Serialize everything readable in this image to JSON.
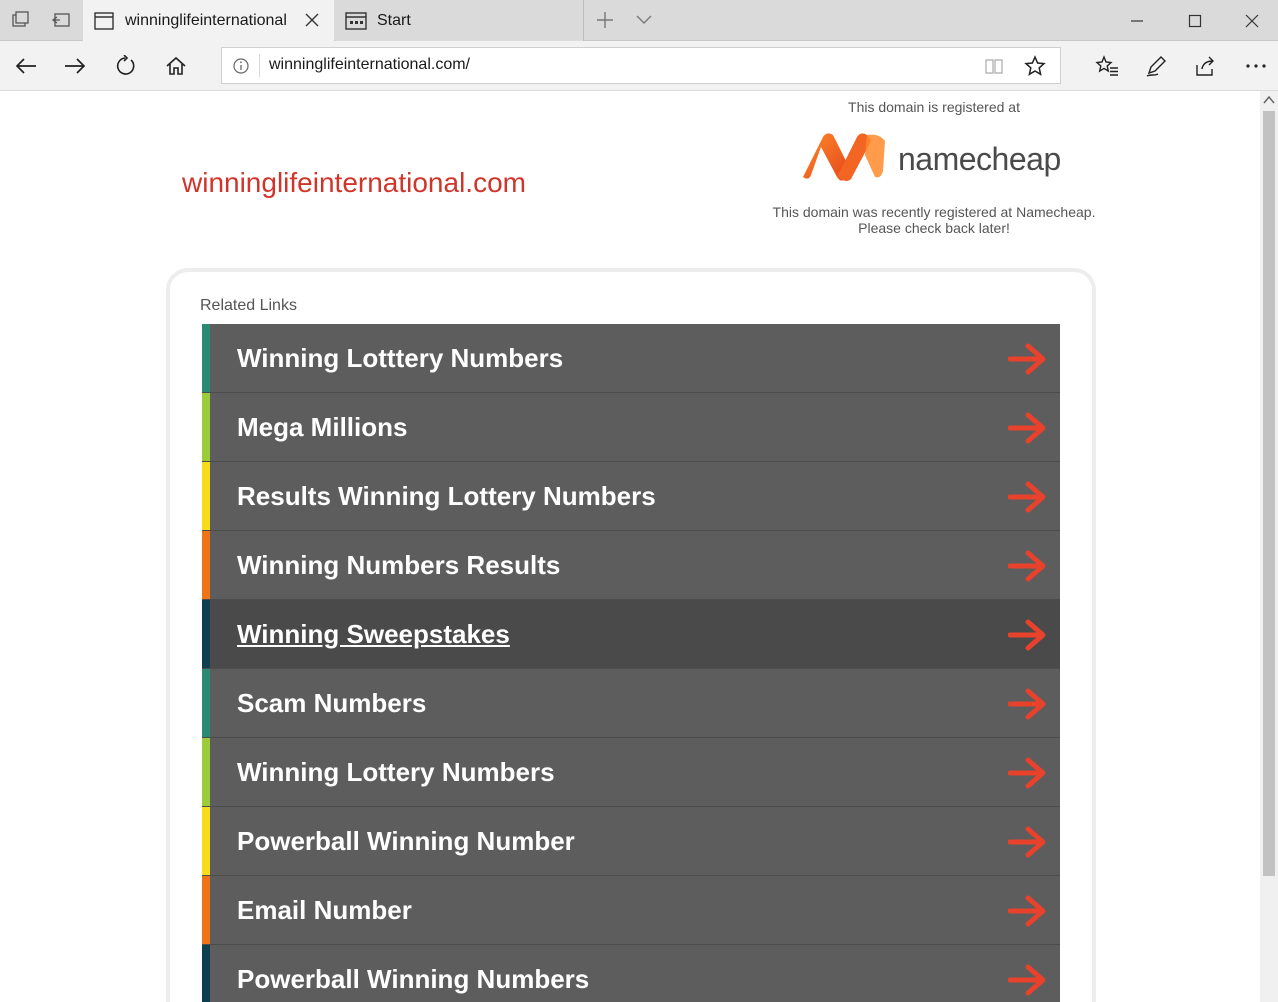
{
  "browser": {
    "tabs": [
      {
        "label": "winninglifeinternational",
        "active": true
      },
      {
        "label": "Start",
        "active": false
      }
    ],
    "url": "winninglifeinternational.com/"
  },
  "page": {
    "domain_title": "winninglifeinternational.com",
    "registrar_notice_top": "This domain is registered at",
    "registrar_name": "namecheap",
    "registrar_notice_line1": "This domain was recently registered at Namecheap.",
    "registrar_notice_line2": "Please check back later!",
    "related_links_heading": "Related Links",
    "related_links": [
      {
        "label": "Winning Lotttery Numbers",
        "stripe": "#2a8a74"
      },
      {
        "label": "Mega Millions",
        "stripe": "#9ccc3a"
      },
      {
        "label": "Results Winning Lottery Numbers",
        "stripe": "#f5dc1c"
      },
      {
        "label": "Winning Numbers Results",
        "stripe": "#ef7317"
      },
      {
        "label": "Winning Sweepstakes",
        "stripe": "#0f3e50",
        "hover": true
      },
      {
        "label": "Scam Numbers",
        "stripe": "#2a8a74"
      },
      {
        "label": "Winning Lottery Numbers",
        "stripe": "#9ccc3a"
      },
      {
        "label": "Powerball Winning Number",
        "stripe": "#f5dc1c"
      },
      {
        "label": "Email Number",
        "stripe": "#ef7317"
      },
      {
        "label": "Powerball Winning Numbers",
        "stripe": "#0f3e50"
      }
    ]
  },
  "colors": {
    "domain_title": "#d0352a",
    "link_row_bg": "#5d5d5d",
    "arrow": "#e8412c",
    "namecheap_orange": "#f26522"
  }
}
